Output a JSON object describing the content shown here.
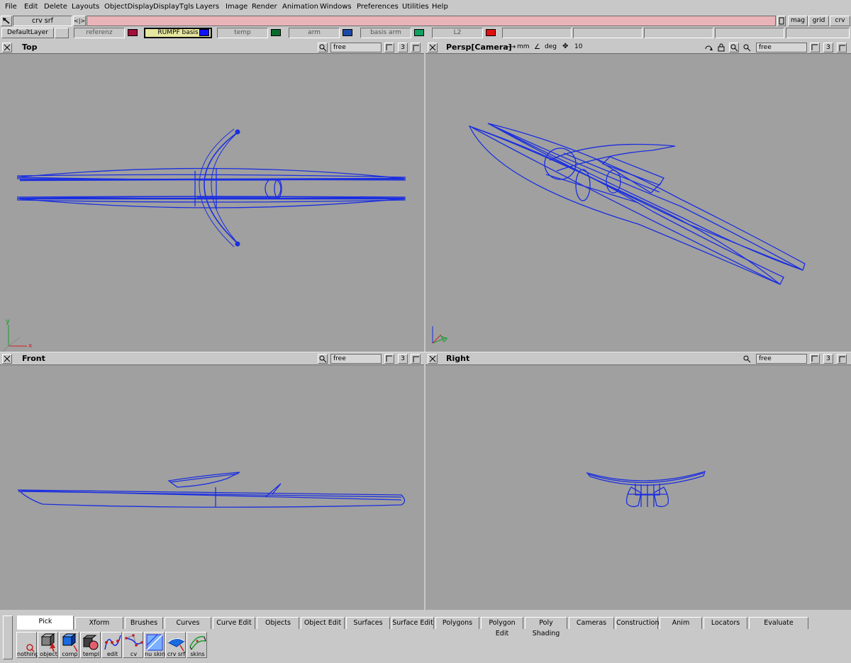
{
  "menu": [
    "File",
    "Edit",
    "Delete",
    "Layouts",
    "ObjectDisplay",
    "DisplayTgls",
    "Layers",
    "Image",
    "Render",
    "Animation",
    "Windows",
    "Preferences",
    "Utilities",
    "Help"
  ],
  "toolbar": {
    "tool_name": "crv srf",
    "arrow_label": "<|>",
    "right_buttons": [
      "mag",
      "grid",
      "crv"
    ]
  },
  "layers": [
    {
      "name": "DefaultLayer",
      "color": ""
    },
    {
      "name": "referenz",
      "color": "#a0103a"
    },
    {
      "name": "RUMPF basis",
      "color": "#1010ff",
      "active": true
    },
    {
      "name": "temp",
      "color": "#0a6a2a"
    },
    {
      "name": "arm",
      "color": "#1a4aa8"
    },
    {
      "name": "basis arm",
      "color": "#10a060"
    },
    {
      "name": "L2",
      "color": "#e01010"
    }
  ],
  "viewports": {
    "top": {
      "title": "Top",
      "field": "free",
      "num": "3"
    },
    "persp": {
      "title": "Persp[Camera]",
      "unit1": "mm",
      "unit2": "deg",
      "num2": "10",
      "field": "free",
      "num": "3"
    },
    "front": {
      "title": "Front",
      "field": "free",
      "num": "3"
    },
    "right": {
      "title": "Right",
      "field": "free",
      "num": "3"
    }
  },
  "axis": {
    "y": "y",
    "x": "x"
  },
  "shelf_tabs": [
    "Pick",
    "Xform",
    "Brushes",
    "Curves",
    "Curve Edit",
    "Objects",
    "Object Edit",
    "Surfaces",
    "Surface Edit",
    "Polygons",
    "Polygon Edit",
    "Poly Shading",
    "Cameras",
    "Construction",
    "Anim",
    "Locators",
    "Evaluate"
  ],
  "tools": [
    "nothing",
    "object",
    "comp",
    "templ",
    "edit",
    "cv",
    "nu skin",
    "crv srf",
    "skins"
  ],
  "colors": {
    "wire": "#1a2ee0",
    "viewport_bg": "#a0a0a0",
    "ui_bg": "#c8c8c8",
    "active_tab": "#ffffff",
    "cmd_field": "#e8b4b8"
  }
}
